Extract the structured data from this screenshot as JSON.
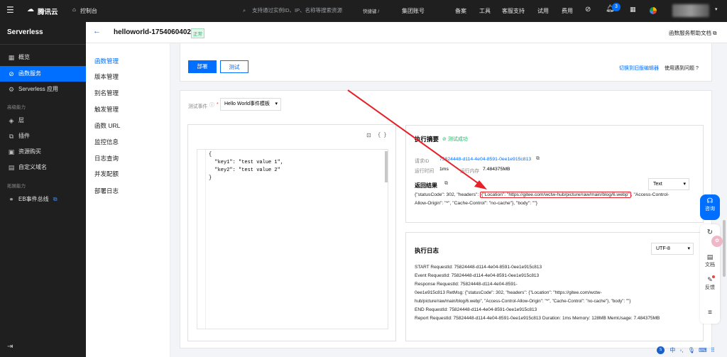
{
  "topnav": {
    "brand": "腾讯云",
    "console": "控制台",
    "search_placeholder": "支持通过实例ID、IP、名称等搜索资源",
    "shortcut": "快捷键 /",
    "links": [
      "集团账号",
      "备案",
      "工具",
      "客服支持",
      "试用",
      "费用"
    ],
    "notification_count": "3"
  },
  "sidebar": {
    "title": "Serverless",
    "items": [
      "概览",
      "函数服务",
      "Serverless 应用"
    ],
    "group_advanced": "高级能力",
    "advanced_items": [
      "层",
      "插件",
      "资源购买",
      "自定义域名"
    ],
    "group_extend": "拓展能力",
    "extend_items": [
      "EB事件总线"
    ]
  },
  "header": {
    "function_name": "helloworld-1754060402",
    "status": "正常",
    "help": "函数服务帮助文档"
  },
  "subnav": [
    "函数管理",
    "版本管理",
    "别名管理",
    "触发管理",
    "函数 URL",
    "监控信息",
    "日志查询",
    "并发配额",
    "部署日志"
  ],
  "actions": {
    "deploy": "部署",
    "test": "测试",
    "switch_editor": "切换到旧版编辑器",
    "problem": "使用遇到问题"
  },
  "test_event": {
    "label": "测试事件",
    "required": "*",
    "template": "Hello World事件模板",
    "code_lines": [
      "{",
      "  \"key1\": \"test value 1\",",
      "  \"key2\": \"test value 2\"",
      "}"
    ],
    "format_icon": "{ }"
  },
  "summary": {
    "title": "执行摘要",
    "status": "测试成功",
    "request_id_label": "请求ID",
    "request_id": "75824448-d114-4e04-8591-0ee1e915c813",
    "run_time_label": "运行时间",
    "run_time": "1ms",
    "memory_label": "运行内存",
    "memory": "7.484375MB",
    "result_title": "返回结果",
    "result_format": "Text",
    "result_pre": "{\"statusCode\": 302, \"headers\": ",
    "result_highlight": "{\"Location\": \"https://gitee.com/wctw-hub/picture/raw/main/blog/6.webp\"",
    "result_post": ", \"Access-Control-",
    "result_line2": "Allow-Origin\": \"*\", \"Cache-Control\": \"no-cache\"}, \"body\": \"\"}"
  },
  "log": {
    "title": "执行日志",
    "encoding": "UTF-8",
    "lines": [
      "START RequestId: 75824448-d114-4e04-8591-0ee1e915c813",
      "Event RequestId: 75824448-d114-4e04-8591-0ee1e915c813",
      "Response RequestId: 75824448-d114-4e04-8591-",
      "0ee1e915c813 RetMsg: {\"statusCode\": 302, \"headers\": {\"Location\": \"https://gitee.com/wctw-",
      "hub/picture/raw/main/blog/6.webp\", \"Access-Control-Allow-Origin\": \"*\", \"Cache-Control\": \"no-cache\"}, \"body\": \"\"}",
      "END RequestId: 75824448-d114-4e04-8591-0ee1e915c813",
      "Report RequestId: 75824448-d114-4e04-8591-0ee1e915c813 Duration: 1ms Memory: 128MB MemUsage: 7.484375MB"
    ]
  },
  "right_tools": {
    "consult": "咨询",
    "docs": "文档",
    "feedback": "反馈"
  },
  "bottom_icons": [
    "中"
  ],
  "colors": {
    "accent": "#006eff",
    "annotation": "#e8202a",
    "success": "#0abf5b"
  }
}
